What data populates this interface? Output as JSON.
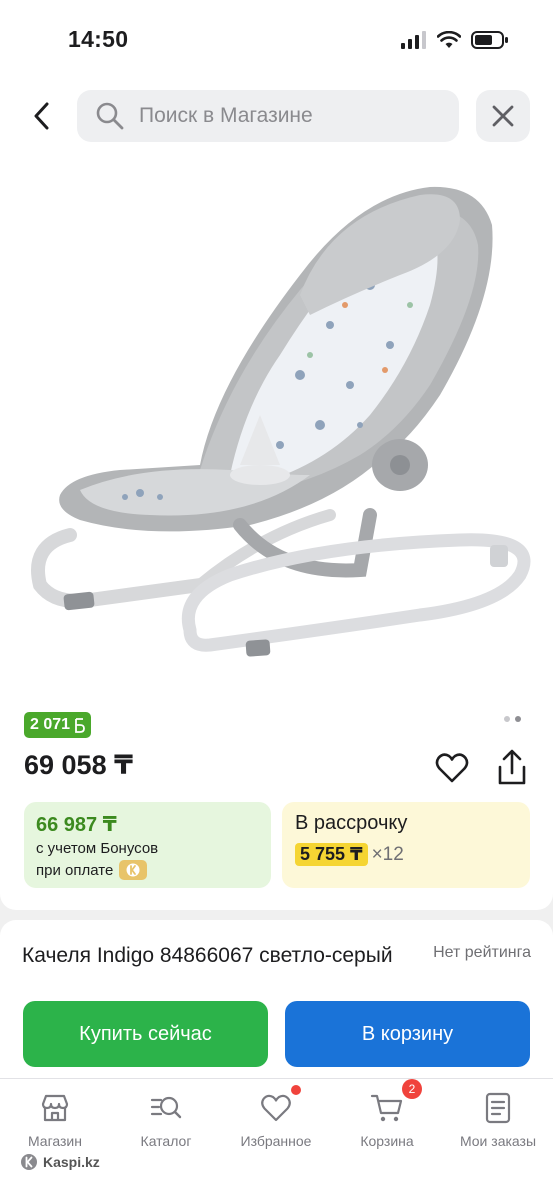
{
  "status_bar": {
    "time": "14:50"
  },
  "search": {
    "placeholder": "Поиск в Магазине"
  },
  "product": {
    "bonus_badge": "2 071",
    "price": "69 058 ₸",
    "title": "Качеля Indigo 84866067 светло-серый",
    "rating": "Нет рейтинга",
    "gallery_pages": 2,
    "gallery_active": 2
  },
  "bonus_card": {
    "amount": "66 987 ₸",
    "line1": "с учетом Бонусов",
    "line2": "при оплате"
  },
  "credit_card": {
    "title": "В рассрочку",
    "monthly": "5 755 ₸",
    "months": "×12"
  },
  "actions": {
    "buy_now": "Купить сейчас",
    "add_to_cart": "В корзину"
  },
  "nav": {
    "items": [
      {
        "label": "Магазин",
        "icon": "store-icon"
      },
      {
        "label": "Каталог",
        "icon": "catalog-search-icon"
      },
      {
        "label": "Избранное",
        "icon": "heart-icon"
      },
      {
        "label": "Корзина",
        "icon": "cart-icon",
        "badge": "2"
      },
      {
        "label": "Мои заказы",
        "icon": "orders-icon"
      }
    ]
  },
  "brand": {
    "name": "Kaspi.kz"
  },
  "colors": {
    "bonus_green": "#4aa82b",
    "buy_green": "#2cb34a",
    "cart_blue": "#1a73d8",
    "credit_yellow": "#f5d533",
    "badge_red": "#f0433c"
  }
}
